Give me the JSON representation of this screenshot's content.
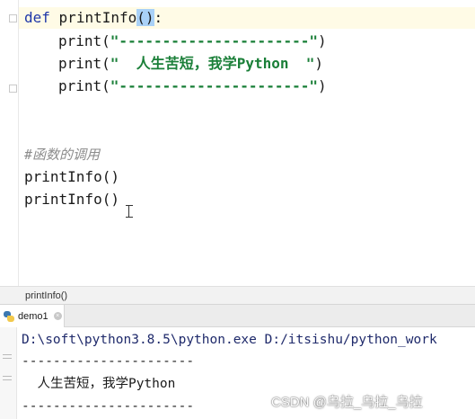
{
  "editor": {
    "line1": {
      "keyword": "def",
      "fn_name": "printInfo",
      "paren_open": "(",
      "paren_close": ")",
      "colon": ":"
    },
    "line2": {
      "call": "print(",
      "arg": "\"----------------------\"",
      "close": ")"
    },
    "line3": {
      "call": "print(",
      "arg": "\"  人生苦短，我学Python  \"",
      "close": ")"
    },
    "line4": {
      "call": "print(",
      "arg": "\"----------------------\"",
      "close": ")"
    },
    "comment": "#函数的调用",
    "call1": "printInfo()",
    "call2": "printInfo()"
  },
  "breadcrumb": {
    "label": "printInfo()"
  },
  "run_panel": {
    "tab_label": "demo1",
    "close_glyph": "×",
    "command": "D:\\soft\\python3.8.5\\python.exe D:/itsishu/python_work",
    "output": [
      "----------------------",
      "  人生苦短，我学Python",
      "----------------------"
    ]
  },
  "watermark": "CSDN @乌拉_乌拉_乌拉",
  "colors": {
    "keyword": "#1d36a8",
    "string": "#1a7f38",
    "comment": "#8c8c8c",
    "match_highlight": "#a9d1f7"
  }
}
